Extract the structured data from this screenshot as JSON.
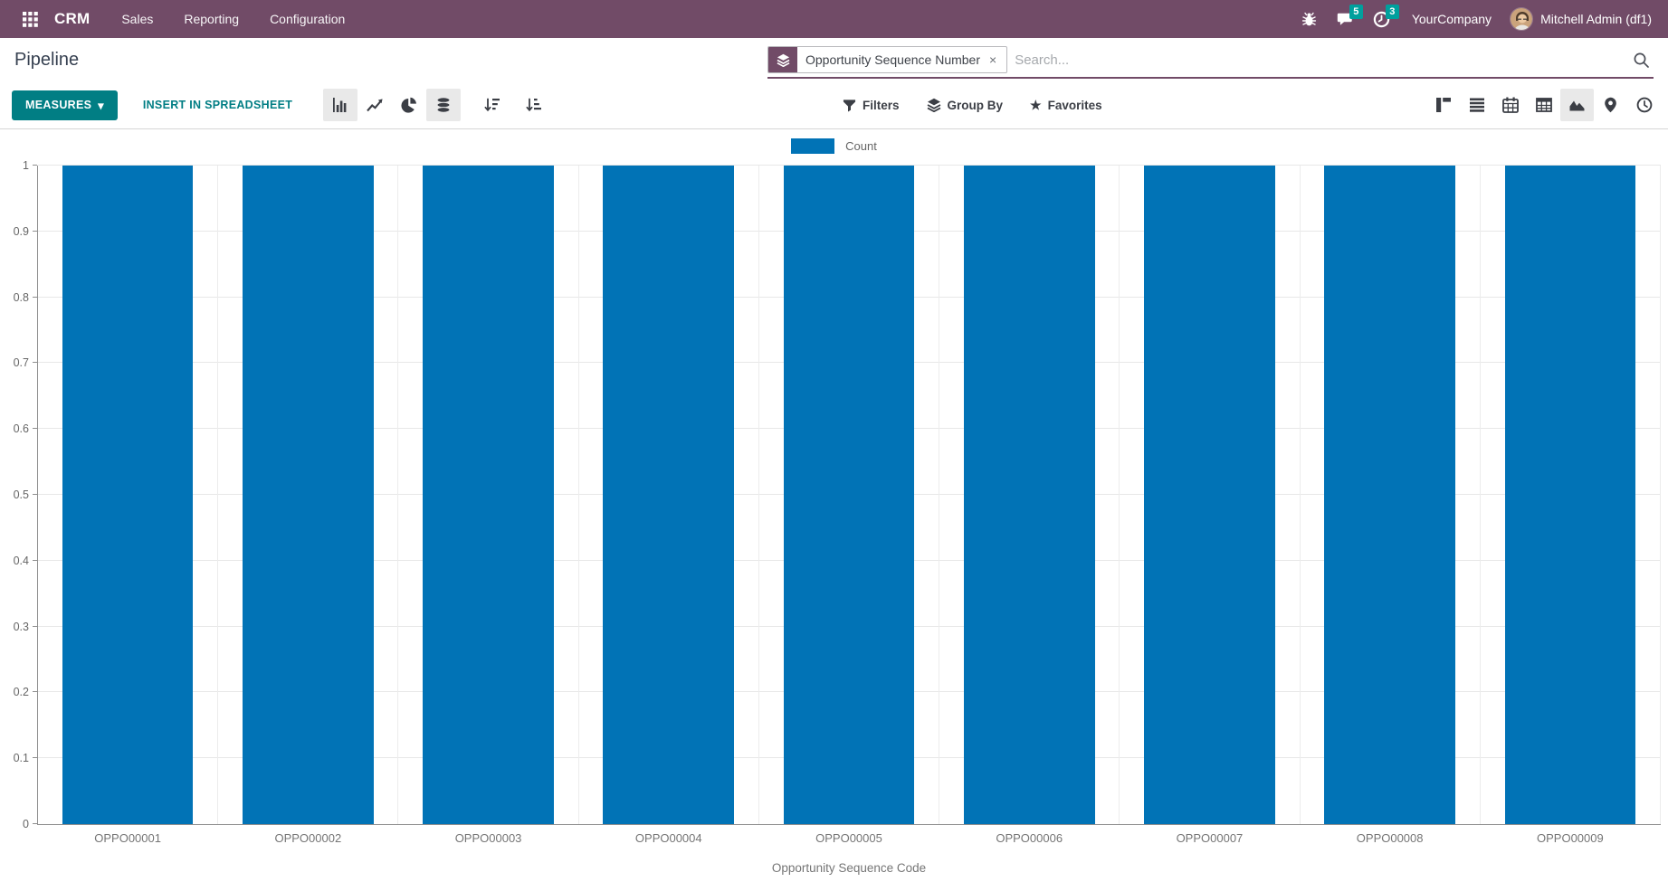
{
  "colors": {
    "navbar": "#714B67",
    "badge": "#00A09D",
    "primary": "#017E84",
    "bar": "#0173b6",
    "icon": "#3b3e45"
  },
  "icons": {
    "caret_down": "▾",
    "close": "×",
    "star": "★"
  },
  "topbar": {
    "app": "CRM",
    "menus": [
      "Sales",
      "Reporting",
      "Configuration"
    ],
    "messages_badge": "5",
    "activities_badge": "3",
    "company": "YourCompany",
    "user": "Mitchell Admin (df1)"
  },
  "header": {
    "title": "Pipeline",
    "search": {
      "facet_label": "Opportunity Sequence Number",
      "placeholder": "Search..."
    }
  },
  "toolbar": {
    "measures": "MEASURES",
    "insert": "INSERT IN SPREADSHEET",
    "filters": "Filters",
    "group_by": "Group By",
    "favorites": "Favorites"
  },
  "chart_data": {
    "type": "bar",
    "title": "",
    "categories": [
      "OPPO00001",
      "OPPO00002",
      "OPPO00003",
      "OPPO00004",
      "OPPO00005",
      "OPPO00006",
      "OPPO00007",
      "OPPO00008",
      "OPPO00009"
    ],
    "series": [
      {
        "name": "Count",
        "values": [
          1,
          1,
          1,
          1,
          1,
          1,
          1,
          1,
          1
        ],
        "color": "#0173b6"
      }
    ],
    "xlabel": "Opportunity Sequence Code",
    "ylabel": "",
    "ylim": [
      0,
      1
    ],
    "yticks": [
      0,
      0.1,
      0.2,
      0.3,
      0.4,
      0.5,
      0.6,
      0.7,
      0.8,
      0.9,
      1
    ],
    "grid": true,
    "legend_position": "top"
  }
}
